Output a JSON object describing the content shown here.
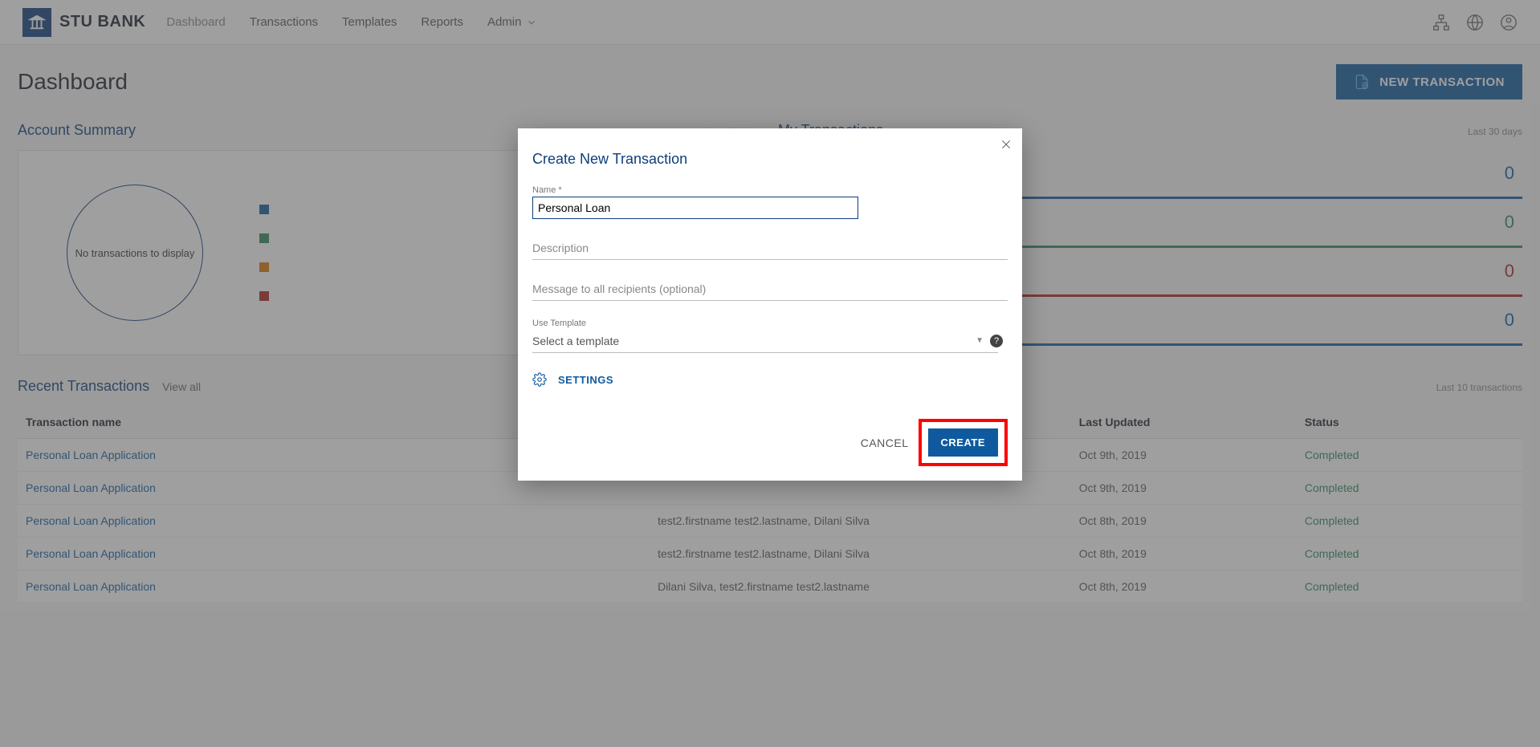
{
  "brand": "STU BANK",
  "nav": {
    "dashboard": "Dashboard",
    "transactions": "Transactions",
    "templates": "Templates",
    "reports": "Reports",
    "admin": "Admin"
  },
  "page": {
    "title": "Dashboard",
    "new_btn": "NEW TRANSACTION",
    "account_summary": "Account Summary",
    "my_transactions": "My Transactions",
    "last30": "Last 30 days",
    "no_tx": "No transactions to display",
    "mytx_counts": {
      "blue": "0",
      "green": "0",
      "red": "0",
      "last_blue": "0"
    }
  },
  "recent": {
    "title": "Recent Transactions",
    "view_all": "View all",
    "lastn": "Last 10 transactions",
    "headers": {
      "name": "Transaction name",
      "recipients": "",
      "updated": "Last Updated",
      "status": "Status"
    },
    "rows": [
      {
        "name": "Personal Loan Application",
        "recipients": "",
        "updated": "Oct 9th, 2019",
        "status": "Completed"
      },
      {
        "name": "Personal Loan Application",
        "recipients": "",
        "updated": "Oct 9th, 2019",
        "status": "Completed"
      },
      {
        "name": "Personal Loan Application",
        "recipients": "test2.firstname test2.lastname, Dilani Silva",
        "updated": "Oct 8th, 2019",
        "status": "Completed"
      },
      {
        "name": "Personal Loan Application",
        "recipients": "test2.firstname test2.lastname, Dilani Silva",
        "updated": "Oct 8th, 2019",
        "status": "Completed"
      },
      {
        "name": "Personal Loan Application",
        "recipients": "Dilani Silva, test2.firstname test2.lastname",
        "updated": "Oct 8th, 2019",
        "status": "Completed"
      }
    ]
  },
  "modal": {
    "title": "Create New Transaction",
    "name_label": "Name *",
    "name_value": "Personal Loan",
    "desc_placeholder": "Description",
    "msg_placeholder": "Message to all recipients (optional)",
    "use_template": "Use Template",
    "select_template": "Select a template",
    "settings": "SETTINGS",
    "cancel": "CANCEL",
    "create": "CREATE"
  }
}
